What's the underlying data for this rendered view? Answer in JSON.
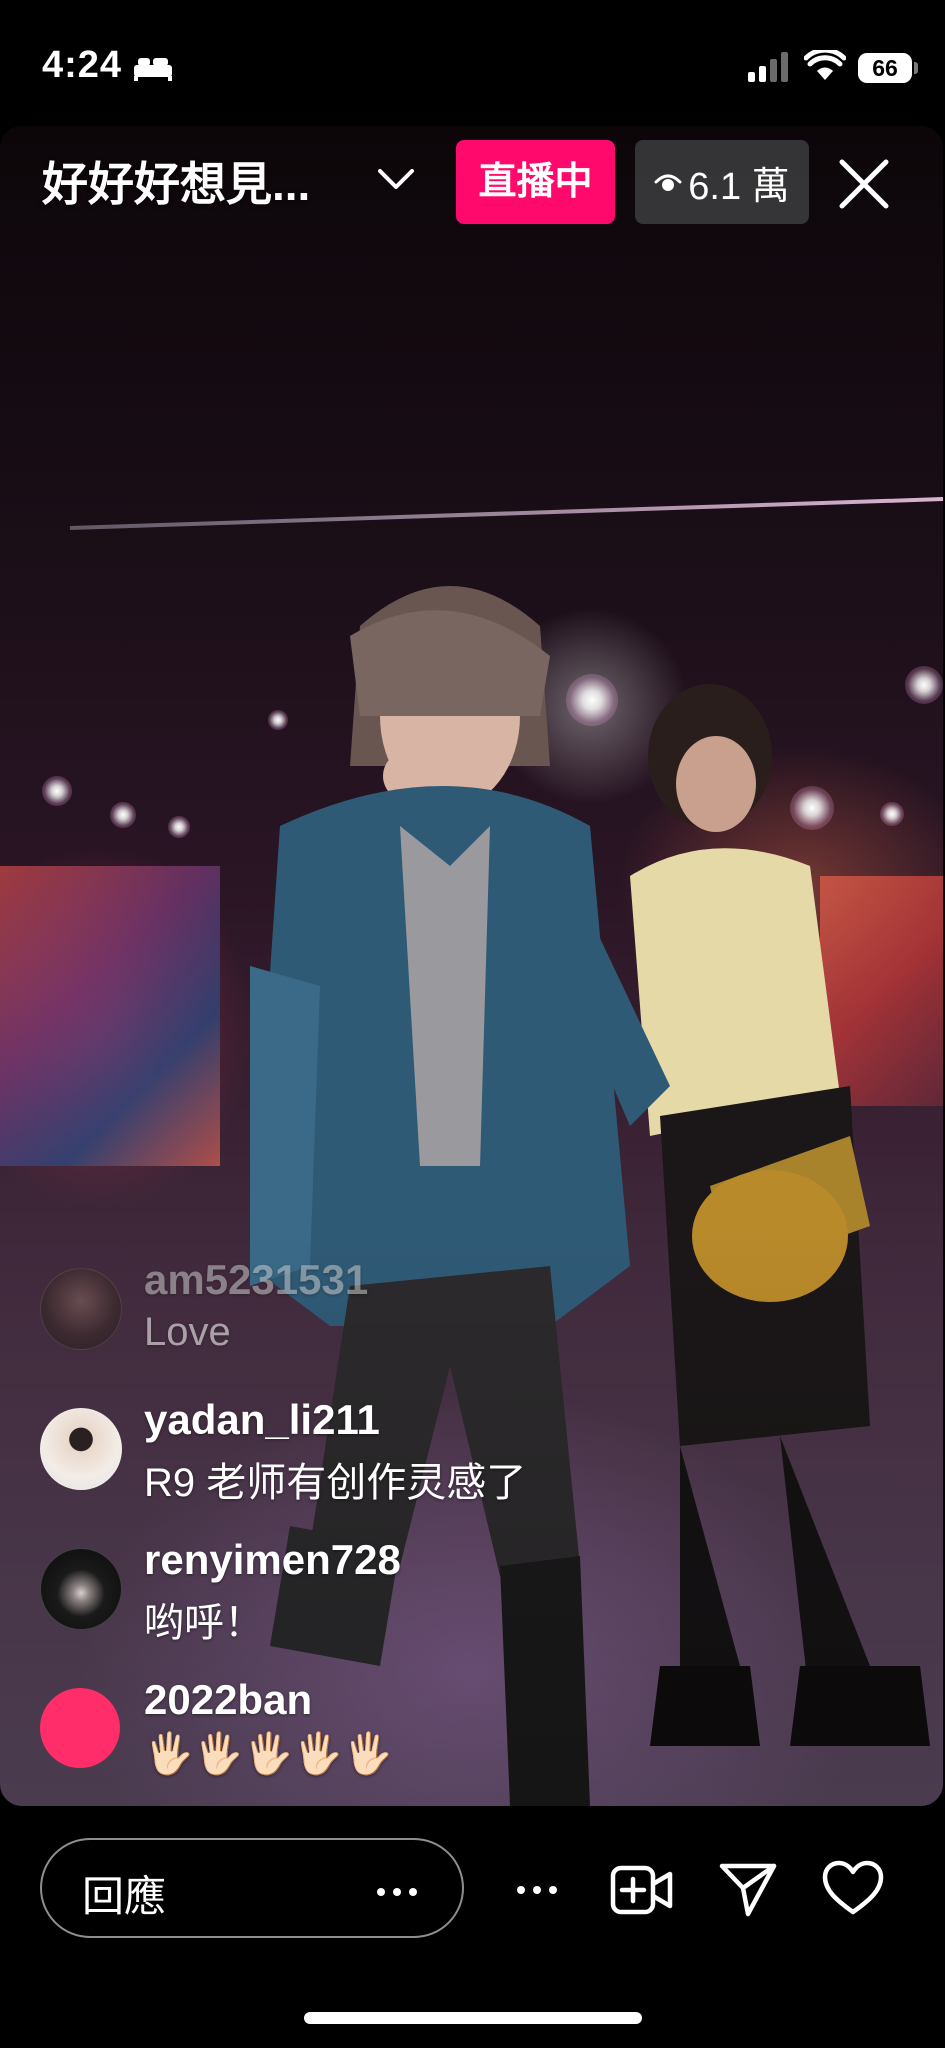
{
  "status_bar": {
    "time": "4:24",
    "battery": "66",
    "icons": [
      "bed-icon",
      "signal-icon",
      "wifi-icon",
      "battery-icon"
    ]
  },
  "live": {
    "title": "好好好想見...",
    "badge": "直播中",
    "viewers": "6.1 萬",
    "icons": [
      "chevron-down-icon",
      "eye-icon",
      "close-icon"
    ]
  },
  "comments": [
    {
      "username": "am5231531",
      "text": "Love"
    },
    {
      "username": "yadan_li211",
      "text": "R9 老师有创作灵感了"
    },
    {
      "username": "renyimen728",
      "text": "哟呼！"
    },
    {
      "username": "2022ban",
      "text": "🖐🏻🖐🏻🖐🏻🖐🏻🖐🏻"
    }
  ],
  "bottom_bar": {
    "reply_label": "回應",
    "icons": [
      "more-icon",
      "video-add-icon",
      "send-icon",
      "heart-icon"
    ]
  },
  "colors": {
    "live_badge": "#ff0a6c",
    "avatar_2022ban": "#ff2d6a"
  }
}
